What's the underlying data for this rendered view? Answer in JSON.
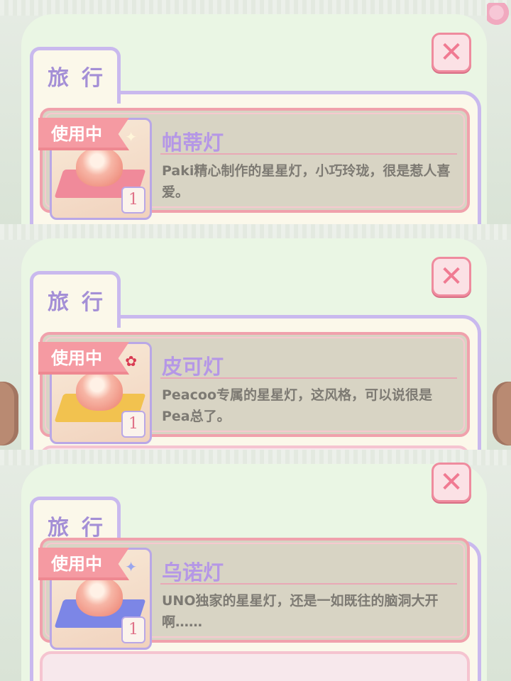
{
  "screens": [
    {
      "tab_label": "旅行",
      "badge": "使用中",
      "title": "帕蒂灯",
      "description": "Paki精心制作的星星灯，小巧玲珑，很是惹人喜爱。",
      "count": "1",
      "cloth_color": "#f08a9a",
      "accent": "pink-cloth"
    },
    {
      "tab_label": "旅行",
      "badge": "使用中",
      "title": "皮可灯",
      "description": "Peacoo专属的星星灯，这风格，可以说很是Pea总了。",
      "count": "1",
      "cloth_color": "#f2c24f",
      "accent": "gold-cloth"
    },
    {
      "tab_label": "旅行",
      "badge": "使用中",
      "title": "乌诺灯",
      "description": "UNO独家的星星灯，还是一如既往的脑洞大开啊……",
      "count": "1",
      "cloth_color": "#7c86e6",
      "accent": "blue-cloth"
    }
  ],
  "colors": {
    "panel_bg": "#eaf6e4",
    "tab_border": "#c9b9ee",
    "badge_bg": "#f59aa2",
    "title_text": "#b597e6",
    "close_x": "#f07a92"
  },
  "icons": {
    "close": "close-icon",
    "lamp": "star-lamp-icon"
  }
}
